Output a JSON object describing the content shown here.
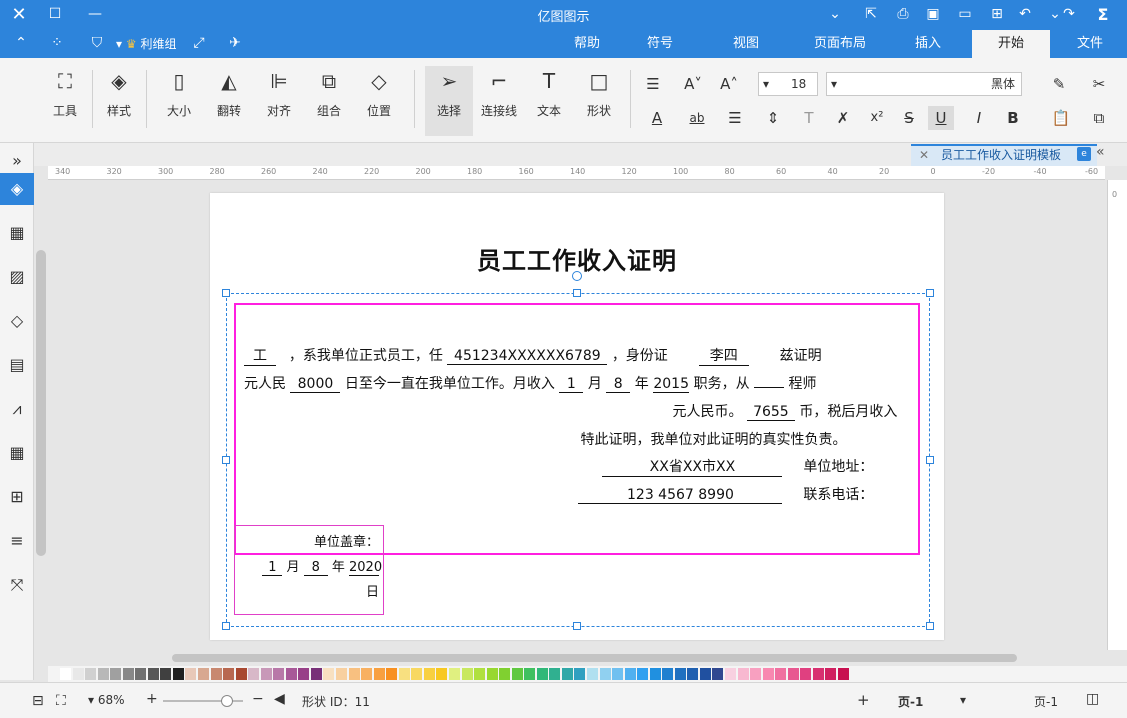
{
  "app": {
    "title": "亿图图示",
    "brand_color": "#2d84db"
  },
  "quick_access": {
    "cloud_label": "利维组"
  },
  "menu_tabs": [
    {
      "label": "文件",
      "active": false
    },
    {
      "label": "开始",
      "active": true
    },
    {
      "label": "插入",
      "active": false
    },
    {
      "label": "页面布局",
      "active": false
    },
    {
      "label": "视图",
      "active": false
    },
    {
      "label": "符号",
      "active": false
    },
    {
      "label": "帮助",
      "active": false
    }
  ],
  "ribbon": {
    "font_name": "黑体",
    "font_size": "18",
    "tools": [
      {
        "label": "形状",
        "icon": "rectangle-icon"
      },
      {
        "label": "文本",
        "icon": "text-T-icon"
      },
      {
        "label": "连接线",
        "icon": "connector-icon"
      },
      {
        "label": "选择",
        "icon": "pointer-icon"
      },
      {
        "label": "位置",
        "icon": "layers-icon"
      },
      {
        "label": "组合",
        "icon": "group-icon"
      },
      {
        "label": "对齐",
        "icon": "align-icon"
      },
      {
        "label": "翻转",
        "icon": "flip-icon"
      },
      {
        "label": "大小",
        "icon": "size-icon"
      },
      {
        "label": "样式",
        "icon": "fill-bucket-icon"
      },
      {
        "label": "工具",
        "icon": "tools-icon"
      }
    ]
  },
  "doc_tab": {
    "label": "员工工作收入证明模板"
  },
  "ruler_labels": [
    "-60",
    "-40",
    "-20",
    "0",
    "20",
    "40",
    "60",
    "80",
    "100",
    "120",
    "140",
    "160",
    "180",
    "200",
    "220",
    "240",
    "260",
    "280",
    "300",
    "320",
    "340"
  ],
  "document": {
    "title": "员工工作收入证明",
    "lines": {
      "l1_a": "兹证明",
      "l1_name": "李四",
      "l1_b": "，身份证",
      "l1_id": "451234XXXXXX6789",
      "l1_c": "，系我单位正式员工，任",
      "l1_pos": "工",
      "l2_pos": "程师",
      "l2_a": "职务，从",
      "l2_year": "2015",
      "l2_b": "年",
      "l2_month": "8",
      "l2_c": "月",
      "l2_day": "1",
      "l2_d": "日至今一直在我单位工作。月收入",
      "l2_income": "8000",
      "l2_e": "元人民",
      "l3_a": "币，税后月收入",
      "l3_after_tax": "7655",
      "l3_b": "元人民币。",
      "l4": "特此证明，我单位对此证明的真实性负责。",
      "l5_label": "单位地址：",
      "l5_value": "XX省XX市XX",
      "l6_label": "联系电话：",
      "l6_value": "123 4567 8990"
    },
    "stamp": {
      "label": "单位盖章：",
      "year": "2020",
      "y_unit": "年",
      "month": "8",
      "m_unit": "月",
      "day": "1",
      "d_unit": "日"
    }
  },
  "status": {
    "page_selector": "页-1",
    "page_tab": "页-1",
    "shape_id": "形状 ID：11",
    "zoom": "68%"
  },
  "palette": [
    "#ffffff",
    "#e8e8e8",
    "#d0d0d0",
    "#b8b8b8",
    "#a0a0a0",
    "#888888",
    "#707070",
    "#585858",
    "#404040",
    "#202020",
    "#e8c8b8",
    "#d8a890",
    "#c88870",
    "#b86850",
    "#a84830",
    "#d8b8c8",
    "#c898b8",
    "#b878a8",
    "#a85898",
    "#984088",
    "#783078",
    "#f8e0c0",
    "#f8d0a0",
    "#f8c080",
    "#f8b060",
    "#f8a040",
    "#f89020",
    "#f8e080",
    "#f8d860",
    "#f8d040",
    "#f8c820",
    "#e0f080",
    "#c8e860",
    "#b0e040",
    "#98d830",
    "#80d030",
    "#60c840",
    "#40c060",
    "#30b878",
    "#30b090",
    "#30a8a8",
    "#30a0c0",
    "#b0e0f0",
    "#90d0f0",
    "#70c0f0",
    "#50b0f0",
    "#30a0f0",
    "#2090e0",
    "#2080d0",
    "#2070c0",
    "#2060b0",
    "#2050a0",
    "#304890",
    "#f8d0e0",
    "#f8b8d0",
    "#f8a0c0",
    "#f888b0",
    "#f070a0",
    "#e85890",
    "#e04080",
    "#d83070",
    "#d02060",
    "#c81050"
  ]
}
